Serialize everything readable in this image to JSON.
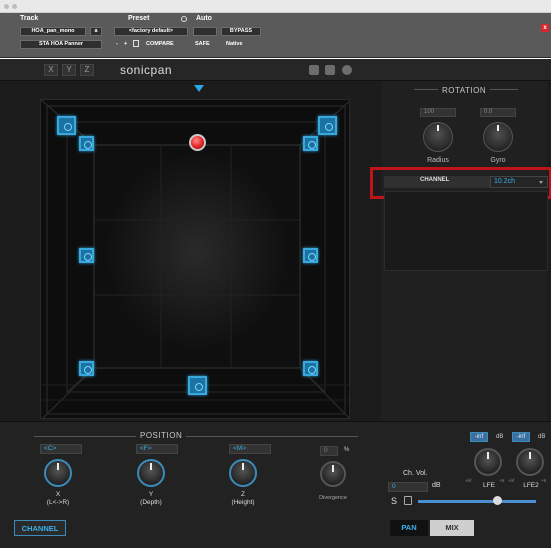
{
  "header": {
    "track_label": "Track",
    "preset_label": "Preset",
    "auto_label": "Auto",
    "track_name": "HOA_pan_mono",
    "track_btn": "a",
    "preset_value": "<factory default>",
    "plugin_name": "STA HOA Panner",
    "compare_label": "COMPARE",
    "bypass_label": "BYPASS",
    "safe_label": "SAFE",
    "native_label": "Native",
    "nav_minus": "-",
    "nav_plus": "+",
    "close_glyph": "x"
  },
  "plugin": {
    "product_name": "sonicpan",
    "axis_buttons": [
      "X",
      "Y",
      "Z"
    ]
  },
  "rotation": {
    "title": "ROTATION",
    "radius_value": "100",
    "gyro_value": "0.0",
    "radius_label": "Radius",
    "gyro_label": "Gyro"
  },
  "channel": {
    "label": "CHANNEL",
    "value": "10.2ch"
  },
  "position": {
    "title": "POSITION",
    "x_value": "<C>",
    "y_value": "<F>",
    "z_value": "<M>",
    "divergence_value": "0",
    "divergence_unit": "%",
    "x_label_1": "X",
    "x_label_2": "(L<->R)",
    "y_label_1": "Y",
    "y_label_2": "(Depth)",
    "z_label_1": "Z",
    "z_label_2": "(Height)",
    "divergence_label": "Divergence"
  },
  "volume": {
    "chvol_label": "Ch. Vol.",
    "value": "0",
    "db_label": "dB",
    "solo_glyph": "S",
    "slider_level": 0.67
  },
  "lfe": {
    "lfe1_value": "-inf",
    "lfe2_value": "-inf",
    "db": "dB",
    "lfe1_label": "LFE",
    "lfe2_label": "LFE2",
    "tick_min": "-inf",
    "tick_max": "+6"
  },
  "footer": {
    "channel_tab": "CHANNEL",
    "pan_tab": "PAN",
    "mix_tab": "MIX"
  },
  "colors": {
    "accent": "#3ab0ea",
    "highlight_box": "#c0141b",
    "source": "#e22424"
  }
}
